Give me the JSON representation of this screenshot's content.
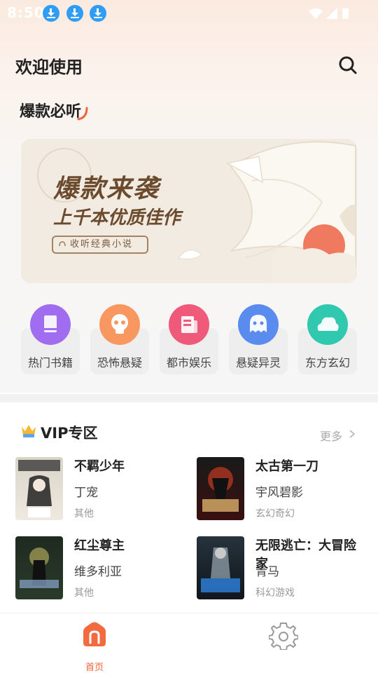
{
  "status_bar": {
    "time": "8:50"
  },
  "header": {
    "title": "欢迎使用"
  },
  "section": {
    "title": "爆款必听"
  },
  "banner": {
    "headline": "爆款来袭",
    "subline": "上千本优质佳作",
    "pill": "收听经典小说"
  },
  "categories": [
    {
      "label": "热门书籍",
      "icon": "book-icon",
      "color": "#a06df0"
    },
    {
      "label": "恐怖悬疑",
      "icon": "skull-icon",
      "color": "#f89860"
    },
    {
      "label": "都市娱乐",
      "icon": "news-icon",
      "color": "#f05a7a"
    },
    {
      "label": "悬疑异灵",
      "icon": "ghost-icon",
      "color": "#5a8cf0"
    },
    {
      "label": "东方玄幻",
      "icon": "cloud-icon",
      "color": "#30c9b0"
    }
  ],
  "vip": {
    "title": "VIP专区",
    "more": "更多"
  },
  "books": [
    {
      "title": "不羁少年",
      "author": "丁宠",
      "category": "其他"
    },
    {
      "title": "太古第一刀",
      "author": "宇风碧影",
      "category": "玄幻奇幻"
    },
    {
      "title": "红尘尊主",
      "author": "维多利亚",
      "category": "其他"
    },
    {
      "title": "无限逃亡：大冒险家",
      "author": "青马",
      "category": "科幻游戏"
    }
  ],
  "tabbar": {
    "home_label": "首页"
  },
  "colors": {
    "accent": "#f0643c",
    "banner_text": "#6b4a2e"
  }
}
